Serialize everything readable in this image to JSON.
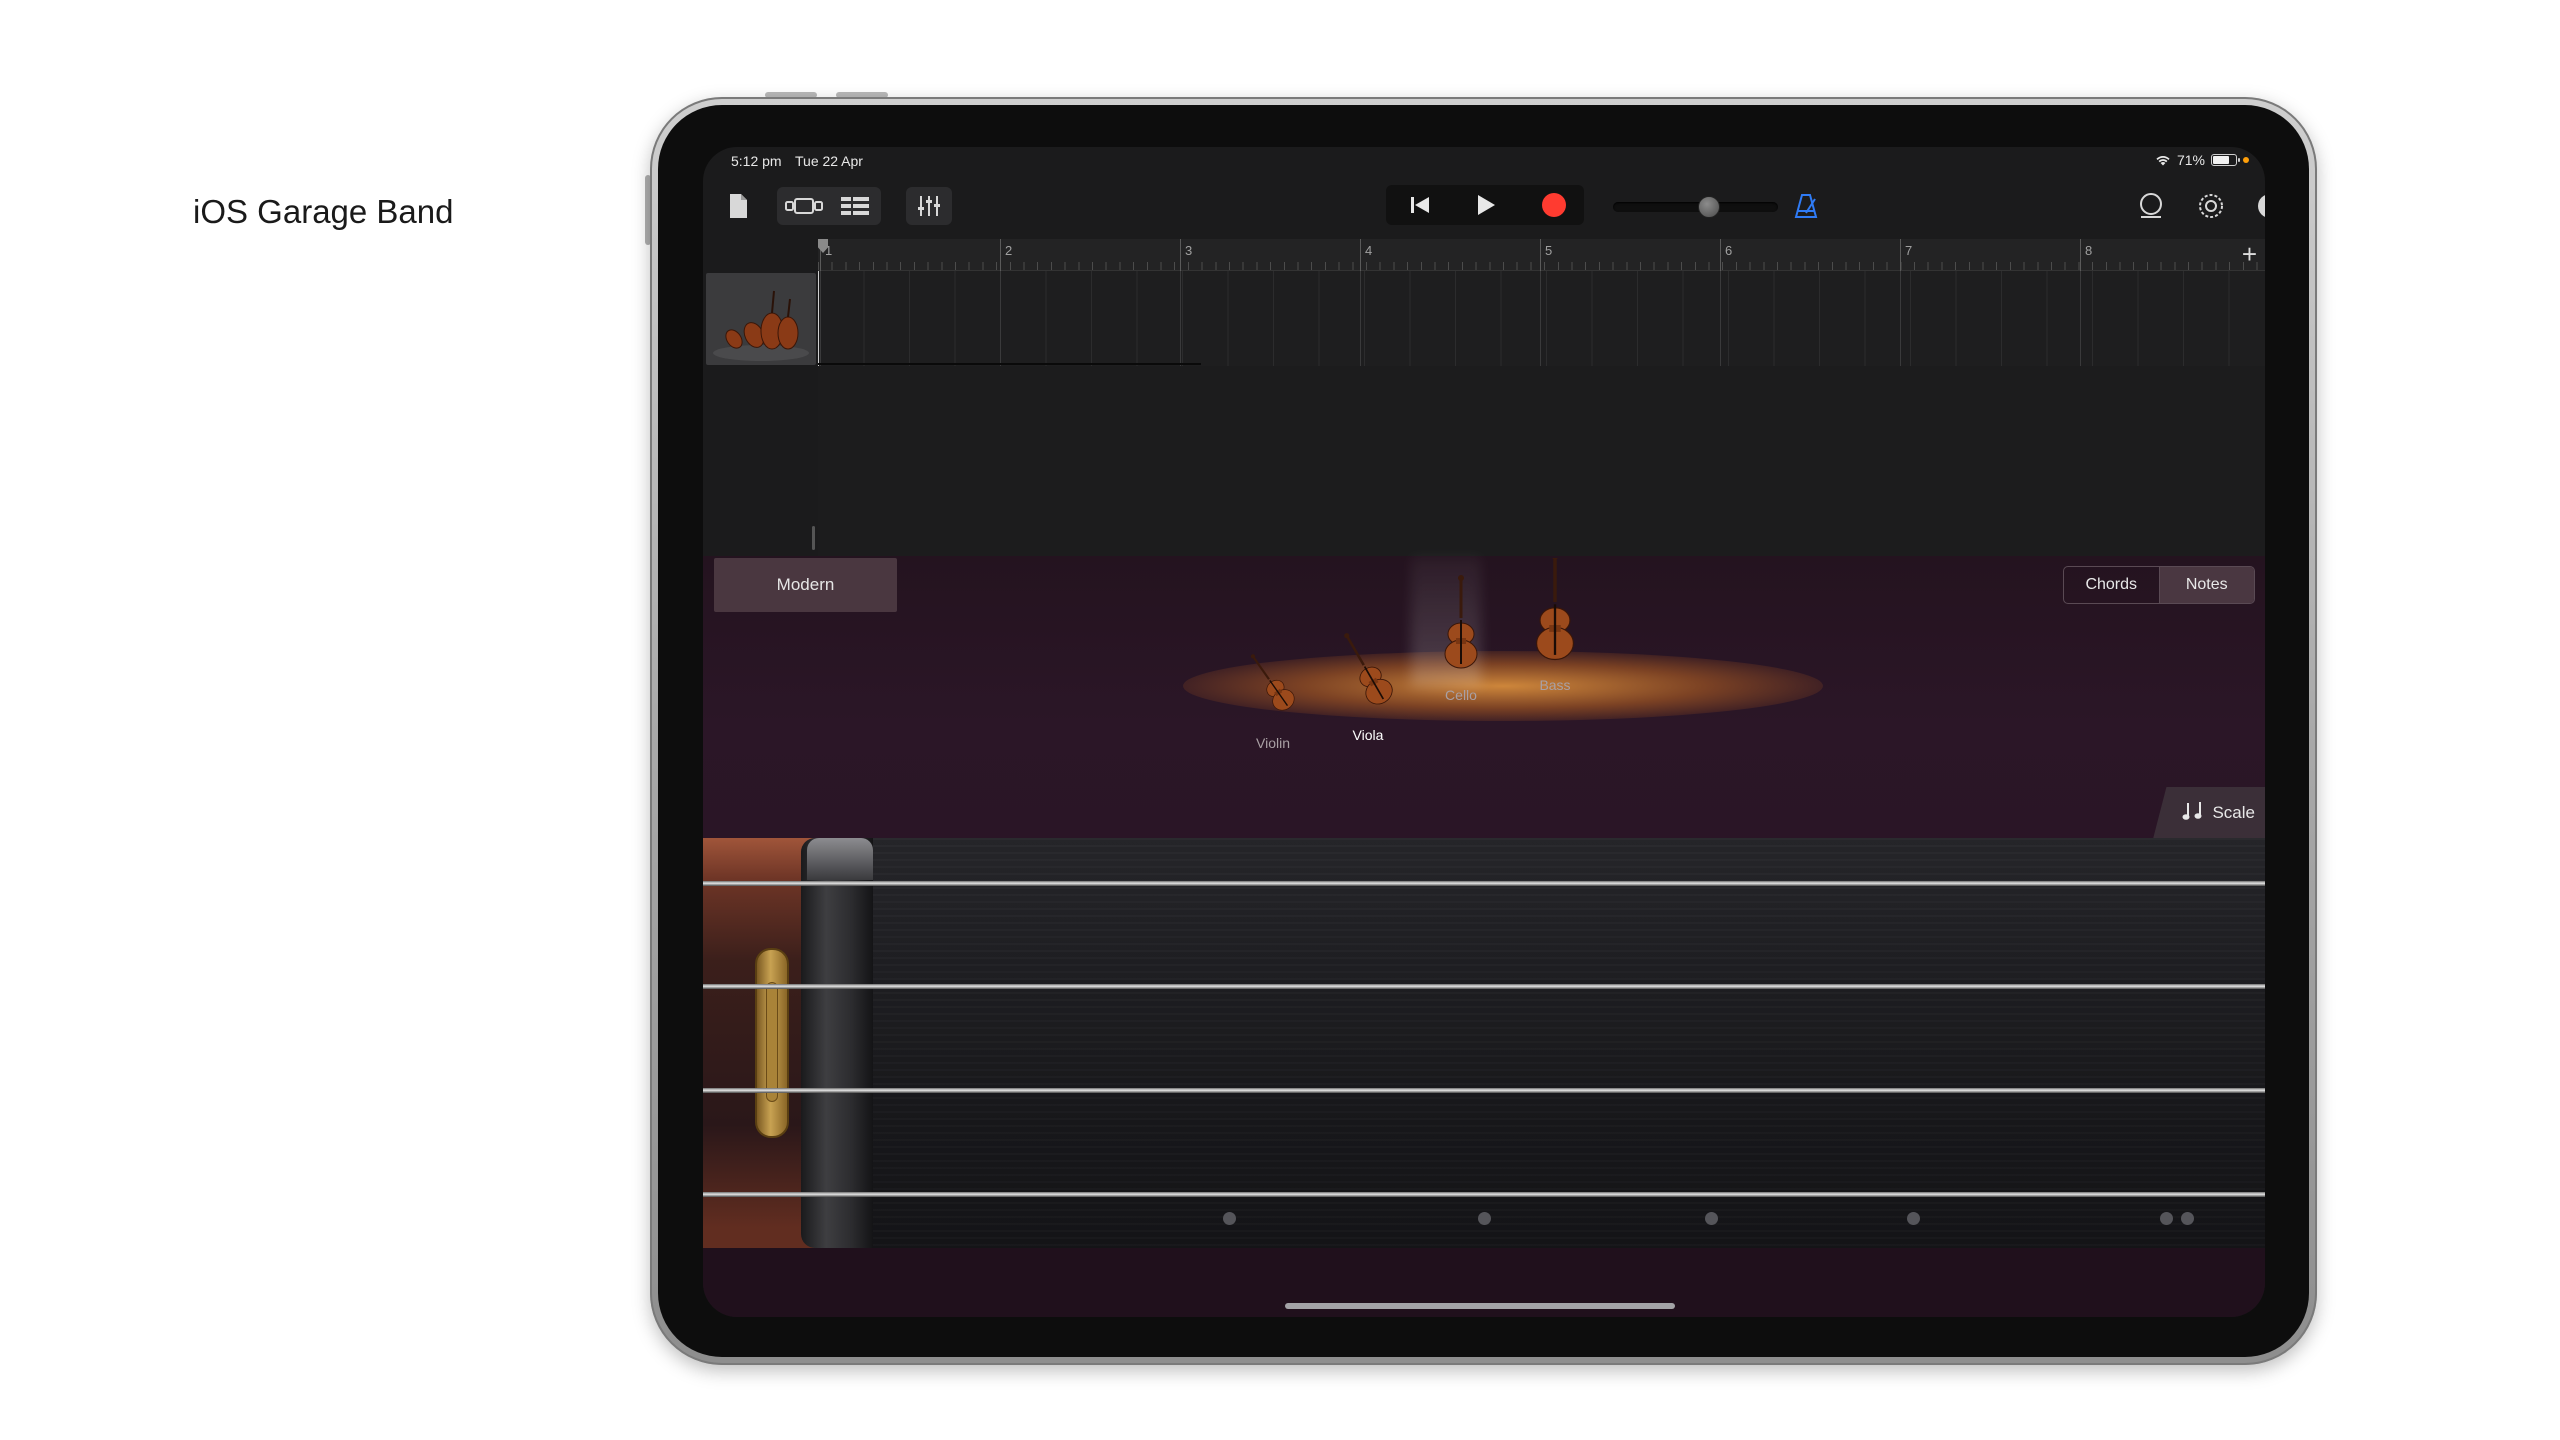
{
  "caption": "iOS Garage Band",
  "status_bar": {
    "time": "5:12 pm",
    "date": "Tue 22 Apr",
    "battery": "71%",
    "battery_level": 0.71,
    "privacy_dot_color": "#ff9f0a"
  },
  "toolbar": {
    "left_icons": [
      "document-icon",
      "view-toggle-icon",
      "tracks-view-icon",
      "mixer-icon"
    ],
    "transport": [
      "rewind-icon",
      "play-icon",
      "record-icon"
    ],
    "record_color": "#ff3b30",
    "master_volume": 0.58,
    "metronome_color": "#2f7bf5",
    "right_icons": [
      "loop-icon",
      "settings-icon",
      "help-icon"
    ]
  },
  "ruler": {
    "bars": [
      "1",
      "2",
      "3",
      "4",
      "5",
      "6",
      "7",
      "8"
    ],
    "add_label": "+"
  },
  "tracks": {
    "add_label": "+"
  },
  "instrument": {
    "preset": "Modern",
    "instruments": [
      {
        "name": "Violin",
        "selected": false
      },
      {
        "name": "Viola",
        "selected": true
      },
      {
        "name": "Cello",
        "selected": false
      },
      {
        "name": "Bass",
        "selected": false
      }
    ],
    "mode": {
      "options": [
        "Chords",
        "Notes"
      ],
      "active": "Notes"
    },
    "scale_label": "Scale"
  }
}
